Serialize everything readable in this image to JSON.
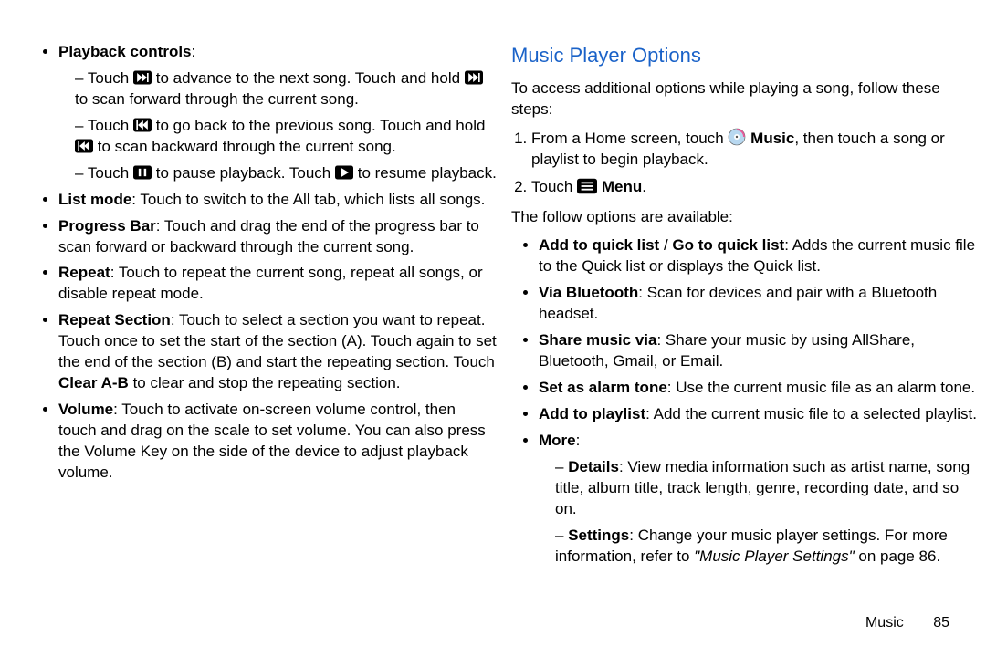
{
  "left": {
    "playback_controls_label": "Playback controls",
    "pc_items": [
      {
        "pre1": "Touch",
        "post1": " to advance to the next song. Touch and hold ",
        "post2": " to scan forward through the current song."
      },
      {
        "pre1": "Touch",
        "post1": " to go back to the previous song. Touch and hold ",
        "post2": " to scan backward through the current song."
      },
      {
        "pre1": "Touch",
        "post1": " to pause playback. Touch ",
        "post2": " to resume playback."
      }
    ],
    "list_mode_label": "List mode",
    "list_mode_text": ": Touch to switch to the All tab, which lists all songs.",
    "progress_label": "Progress Bar",
    "progress_text": ": Touch and drag the end of the progress bar to scan forward or backward through the current song.",
    "repeat_label": "Repeat",
    "repeat_text": ": Touch to repeat the current song, repeat all songs, or disable repeat mode.",
    "repeat_section_label": "Repeat Section",
    "repeat_section_text1": ": Touch to select a section you want to repeat. Touch once to set the start of the section (A). Touch again to set the end of the section (B) and start the repeating section. Touch ",
    "repeat_section_clear": "Clear A-B",
    "repeat_section_text2": " to clear and stop the repeating section.",
    "volume_label": "Volume",
    "volume_text": ": Touch to activate on-screen volume control, then touch and drag on the scale to set volume. You can also press the Volume Key on the side of the device to adjust playback volume."
  },
  "right": {
    "heading": "Music Player Options",
    "intro": "To access additional options while playing a song, follow these steps:",
    "step1_pre": "From a Home screen, touch ",
    "step1_music": " Music",
    "step1_post": ", then touch a song or playlist to begin playback.",
    "step2_pre": "Touch ",
    "step2_menu": " Menu",
    "step2_post": ".",
    "options_intro": "The follow options are available:",
    "add_quick_label": "Add to quick list",
    "slash": " / ",
    "go_quick_label": "Go to quick list",
    "add_quick_text": ": Adds the current music file to the Quick list or displays the Quick list.",
    "via_bt_label": "Via Bluetooth",
    "via_bt_text": ": Scan for devices and pair with a Bluetooth headset.",
    "share_label": "Share music via",
    "share_text": ": Share your music by using AllShare, Bluetooth, Gmail, or Email.",
    "alarm_label": "Set as alarm tone",
    "alarm_text": ": Use the current music file as an alarm tone.",
    "add_playlist_label": "Add to playlist",
    "add_playlist_text": ": Add the current music file to a selected playlist.",
    "more_label": "More",
    "more_colon": ":",
    "details_label": "Details",
    "details_text": ": View media information such as artist name, song title, album title, track length, genre, recording date, and so on.",
    "settings_label": "Settings",
    "settings_text1": ": Change your music player settings. For more information, refer to ",
    "settings_ref": "\"Music Player Settings\"",
    "settings_text2": " on page 86."
  },
  "footer": {
    "section": "Music",
    "page": "85"
  }
}
